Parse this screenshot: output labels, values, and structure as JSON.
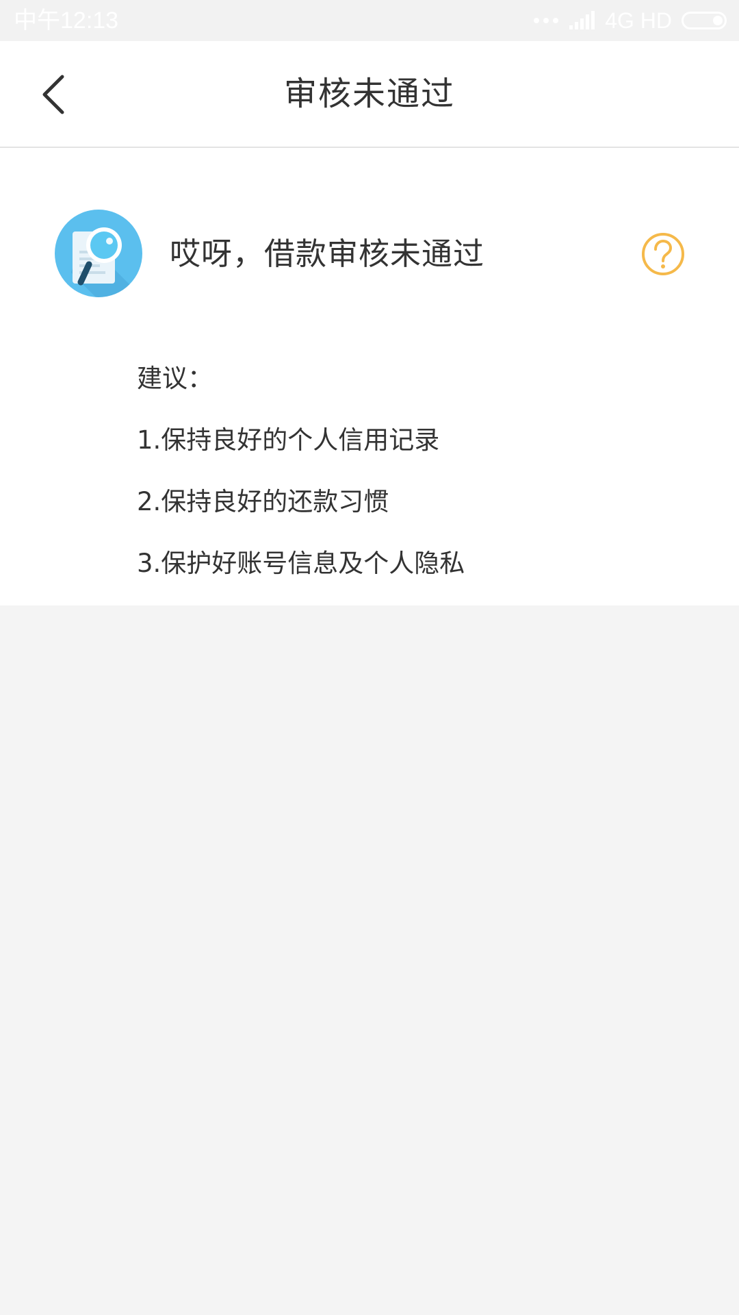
{
  "status_bar": {
    "time": "中午12:13",
    "network": "4G HD"
  },
  "nav": {
    "title": "审核未通过",
    "back_icon": "chevron-left-icon"
  },
  "result": {
    "icon": "document-magnifier-icon",
    "title": "哎呀，借款审核未通过",
    "help_icon": "question-circle-icon",
    "help_color": "#f5b94a"
  },
  "suggestions": {
    "heading": "建议：",
    "items": [
      "1.保持良好的个人信用记录",
      "2.保持良好的还款习惯",
      "3.保护好账号信息及个人隐私"
    ]
  },
  "colors": {
    "accent_blue": "#5bbfee",
    "background": "#f4f4f4"
  }
}
